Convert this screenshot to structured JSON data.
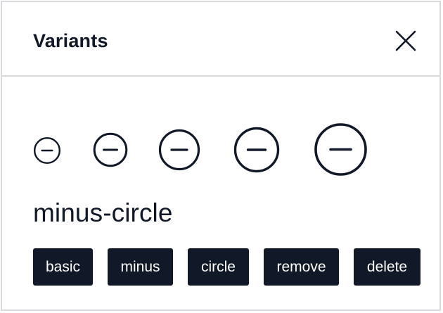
{
  "dialog": {
    "title": "Variants",
    "close_icon": "close-icon"
  },
  "icon": {
    "name": "minus-circle",
    "glyph": "minus-circle-icon",
    "variant_count": 5
  },
  "tags": [
    {
      "label": "basic"
    },
    {
      "label": "minus"
    },
    {
      "label": "circle"
    },
    {
      "label": "remove"
    },
    {
      "label": "delete"
    }
  ],
  "colors": {
    "text": "#111827",
    "tag_background": "#111827",
    "tag_text": "#ffffff",
    "border": "#d9dadd",
    "background": "#ffffff"
  }
}
